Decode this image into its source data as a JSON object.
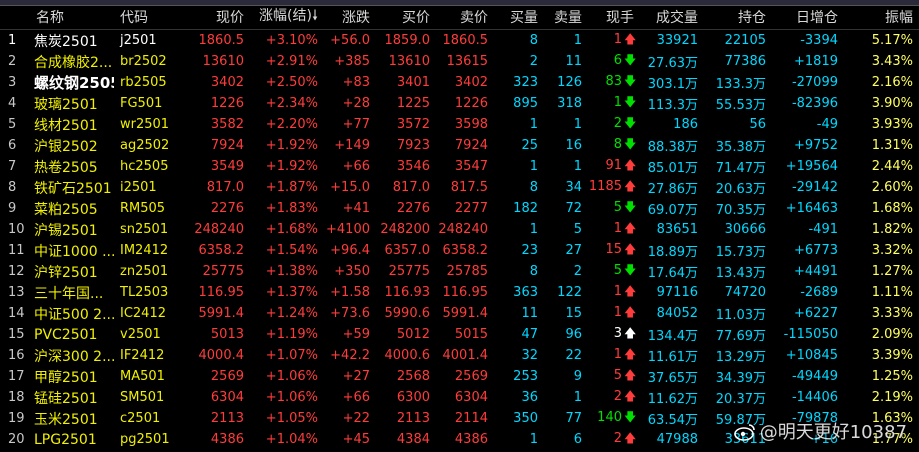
{
  "headers": {
    "name": "名称",
    "code": "代码",
    "price": "现价",
    "pct": "涨幅(结)",
    "change": "涨跌",
    "bid": "买价",
    "ask": "卖价",
    "bidqty": "买量",
    "askqty": "卖量",
    "hand": "现手",
    "volume": "成交量",
    "oi": "持仓",
    "dayoi": "日增仓",
    "amp": "振幅"
  },
  "rows": [
    {
      "idx": "1",
      "name": "焦炭2501",
      "code": "j2501",
      "price": "1860.5",
      "pct": "+3.10%",
      "change": "+56.0",
      "bid": "1859.0",
      "ask": "1860.5",
      "bidqty": "8",
      "askqty": "1",
      "hand": "1",
      "dir": "up",
      "volume": "33921",
      "oi": "22105",
      "dayoi": "-3394",
      "amp": "5.17%"
    },
    {
      "idx": "2",
      "name": "合成橡胶2...",
      "code": "br2502",
      "price": "13610",
      "pct": "+2.91%",
      "change": "+385",
      "bid": "13610",
      "ask": "13615",
      "bidqty": "2",
      "askqty": "11",
      "hand": "6",
      "dir": "down",
      "volume": "27.63万",
      "oi": "77386",
      "dayoi": "+1819",
      "amp": "3.43%"
    },
    {
      "idx": "3",
      "name": "螺纹钢2505",
      "code": "rb2505",
      "price": "3402",
      "pct": "+2.50%",
      "change": "+83",
      "bid": "3401",
      "ask": "3402",
      "bidqty": "323",
      "askqty": "126",
      "hand": "83",
      "dir": "down",
      "volume": "303.1万",
      "oi": "133.3万",
      "dayoi": "-27099",
      "amp": "2.16%"
    },
    {
      "idx": "4",
      "name": "玻璃2501",
      "code": "FG501",
      "price": "1226",
      "pct": "+2.34%",
      "change": "+28",
      "bid": "1225",
      "ask": "1226",
      "bidqty": "895",
      "askqty": "318",
      "hand": "1",
      "dir": "down",
      "volume": "113.3万",
      "oi": "55.53万",
      "dayoi": "-82396",
      "amp": "3.90%"
    },
    {
      "idx": "5",
      "name": "线材2501",
      "code": "wr2501",
      "price": "3582",
      "pct": "+2.20%",
      "change": "+77",
      "bid": "3572",
      "ask": "3598",
      "bidqty": "1",
      "askqty": "1",
      "hand": "2",
      "dir": "down",
      "volume": "186",
      "oi": "56",
      "dayoi": "-49",
      "amp": "3.93%"
    },
    {
      "idx": "6",
      "name": "沪银2502",
      "code": "ag2502",
      "price": "7924",
      "pct": "+1.92%",
      "change": "+149",
      "bid": "7923",
      "ask": "7924",
      "bidqty": "25",
      "askqty": "16",
      "hand": "8",
      "dir": "down",
      "volume": "88.38万",
      "oi": "35.38万",
      "dayoi": "+9752",
      "amp": "1.31%"
    },
    {
      "idx": "7",
      "name": "热卷2505",
      "code": "hc2505",
      "price": "3549",
      "pct": "+1.92%",
      "change": "+66",
      "bid": "3546",
      "ask": "3547",
      "bidqty": "1",
      "askqty": "1",
      "hand": "91",
      "dir": "up",
      "volume": "85.01万",
      "oi": "71.47万",
      "dayoi": "+19564",
      "amp": "2.44%"
    },
    {
      "idx": "8",
      "name": "铁矿石2501",
      "code": "i2501",
      "price": "817.0",
      "pct": "+1.87%",
      "change": "+15.0",
      "bid": "817.0",
      "ask": "817.5",
      "bidqty": "8",
      "askqty": "34",
      "hand": "1185",
      "dir": "up",
      "volume": "27.86万",
      "oi": "20.63万",
      "dayoi": "-29142",
      "amp": "2.60%"
    },
    {
      "idx": "9",
      "name": "菜粕2505",
      "code": "RM505",
      "price": "2276",
      "pct": "+1.83%",
      "change": "+41",
      "bid": "2276",
      "ask": "2277",
      "bidqty": "182",
      "askqty": "72",
      "hand": "5",
      "dir": "down",
      "volume": "69.07万",
      "oi": "70.35万",
      "dayoi": "+16463",
      "amp": "1.68%"
    },
    {
      "idx": "10",
      "name": "沪锡2501",
      "code": "sn2501",
      "price": "248240",
      "pct": "+1.68%",
      "change": "+4100",
      "bid": "248200",
      "ask": "248240",
      "bidqty": "1",
      "askqty": "5",
      "hand": "1",
      "dir": "up",
      "volume": "83651",
      "oi": "30666",
      "dayoi": "-491",
      "amp": "1.82%"
    },
    {
      "idx": "11",
      "name": "中证1000 ...",
      "code": "IM2412",
      "price": "6358.2",
      "pct": "+1.54%",
      "change": "+96.4",
      "bid": "6357.0",
      "ask": "6358.2",
      "bidqty": "23",
      "askqty": "27",
      "hand": "15",
      "dir": "up",
      "volume": "18.89万",
      "oi": "15.73万",
      "dayoi": "+6773",
      "amp": "3.32%"
    },
    {
      "idx": "12",
      "name": "沪锌2501",
      "code": "zn2501",
      "price": "25775",
      "pct": "+1.38%",
      "change": "+350",
      "bid": "25775",
      "ask": "25785",
      "bidqty": "8",
      "askqty": "2",
      "hand": "5",
      "dir": "down",
      "volume": "17.64万",
      "oi": "13.43万",
      "dayoi": "+4491",
      "amp": "1.27%"
    },
    {
      "idx": "13",
      "name": "三十年国...",
      "code": "TL2503",
      "price": "116.95",
      "pct": "+1.37%",
      "change": "+1.58",
      "bid": "116.93",
      "ask": "116.95",
      "bidqty": "363",
      "askqty": "122",
      "hand": "1",
      "dir": "up",
      "volume": "97116",
      "oi": "74720",
      "dayoi": "-2689",
      "amp": "1.11%"
    },
    {
      "idx": "14",
      "name": "中证500 2...",
      "code": "IC2412",
      "price": "5991.4",
      "pct": "+1.24%",
      "change": "+73.6",
      "bid": "5990.6",
      "ask": "5991.4",
      "bidqty": "11",
      "askqty": "15",
      "hand": "1",
      "dir": "up",
      "volume": "84052",
      "oi": "11.03万",
      "dayoi": "+6227",
      "amp": "3.33%"
    },
    {
      "idx": "15",
      "name": "PVC2501",
      "code": "v2501",
      "price": "5013",
      "pct": "+1.19%",
      "change": "+59",
      "bid": "5012",
      "ask": "5015",
      "bidqty": "47",
      "askqty": "96",
      "hand": "3",
      "dir": "upw",
      "volume": "134.4万",
      "oi": "77.69万",
      "dayoi": "-115050",
      "amp": "2.09%"
    },
    {
      "idx": "16",
      "name": "沪深300 2...",
      "code": "IF2412",
      "price": "4000.4",
      "pct": "+1.07%",
      "change": "+42.2",
      "bid": "4000.6",
      "ask": "4001.4",
      "bidqty": "32",
      "askqty": "22",
      "hand": "1",
      "dir": "up",
      "volume": "11.61万",
      "oi": "13.29万",
      "dayoi": "+10845",
      "amp": "3.39%"
    },
    {
      "idx": "17",
      "name": "甲醇2501",
      "code": "MA501",
      "price": "2569",
      "pct": "+1.06%",
      "change": "+27",
      "bid": "2568",
      "ask": "2569",
      "bidqty": "253",
      "askqty": "9",
      "hand": "5",
      "dir": "up",
      "volume": "37.65万",
      "oi": "34.39万",
      "dayoi": "-49449",
      "amp": "1.25%"
    },
    {
      "idx": "18",
      "name": "锰硅2501",
      "code": "SM501",
      "price": "6304",
      "pct": "+1.06%",
      "change": "+66",
      "bid": "6300",
      "ask": "6304",
      "bidqty": "36",
      "askqty": "1",
      "hand": "2",
      "dir": "up",
      "volume": "11.62万",
      "oi": "20.37万",
      "dayoi": "-14406",
      "amp": "2.19%"
    },
    {
      "idx": "19",
      "name": "玉米2501",
      "code": "c2501",
      "price": "2113",
      "pct": "+1.05%",
      "change": "+22",
      "bid": "2113",
      "ask": "2114",
      "bidqty": "350",
      "askqty": "77",
      "hand": "140",
      "dir": "down",
      "volume": "63.54万",
      "oi": "59.87万",
      "dayoi": "-79878",
      "amp": "1.63%"
    },
    {
      "idx": "20",
      "name": "LPG2501",
      "code": "pg2501",
      "price": "4386",
      "pct": "+1.04%",
      "change": "+45",
      "bid": "4384",
      "ask": "4386",
      "bidqty": "1",
      "askqty": "6",
      "hand": "2",
      "dir": "up",
      "volume": "47988",
      "oi": "33611",
      "dayoi": "+16",
      "amp": "1.77%"
    }
  ],
  "watermark": "@明天更好10387",
  "icons": {
    "up": "up-arrow-icon",
    "down": "down-arrow-icon",
    "sort": "sort-desc-icon"
  },
  "colors": {
    "rise": "#ff3c3c",
    "fall": "#00e000",
    "volume": "#00d8ff",
    "name": "#f0f000",
    "selected": "#3a1a8a"
  }
}
